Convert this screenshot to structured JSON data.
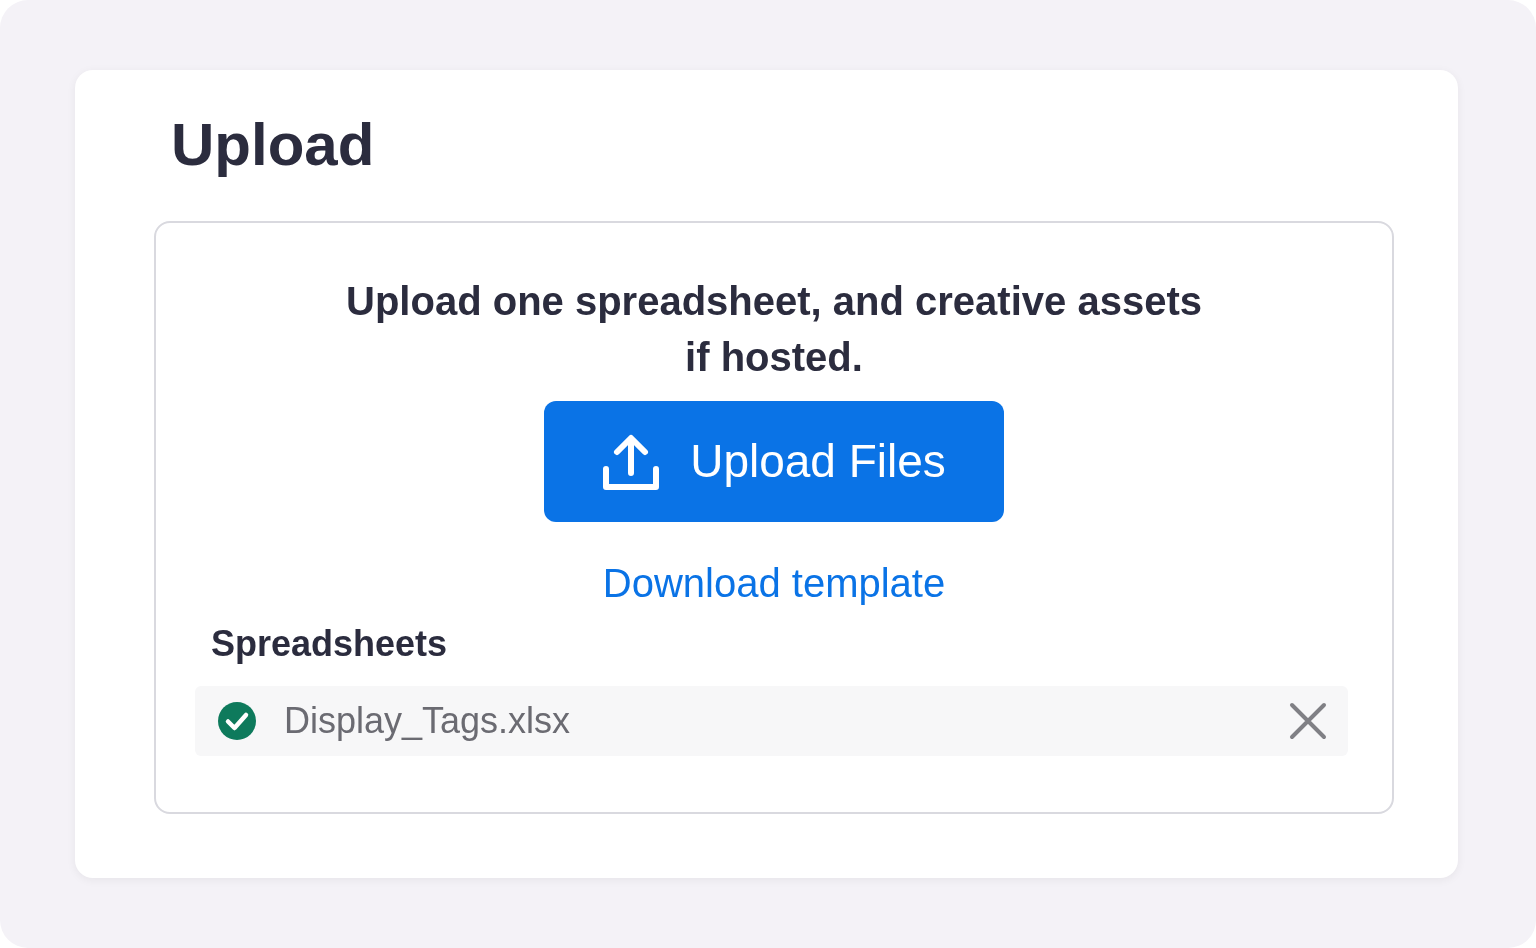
{
  "title": "Upload",
  "instructions": "Upload one spreadsheet, and creative assets if hosted.",
  "upload_button": {
    "label": "Upload Files"
  },
  "download_link": "Download template",
  "spreadsheets": {
    "heading": "Spreadsheets",
    "files": [
      {
        "name": "Display_Tags.xlsx",
        "uploaded": true
      }
    ]
  }
}
